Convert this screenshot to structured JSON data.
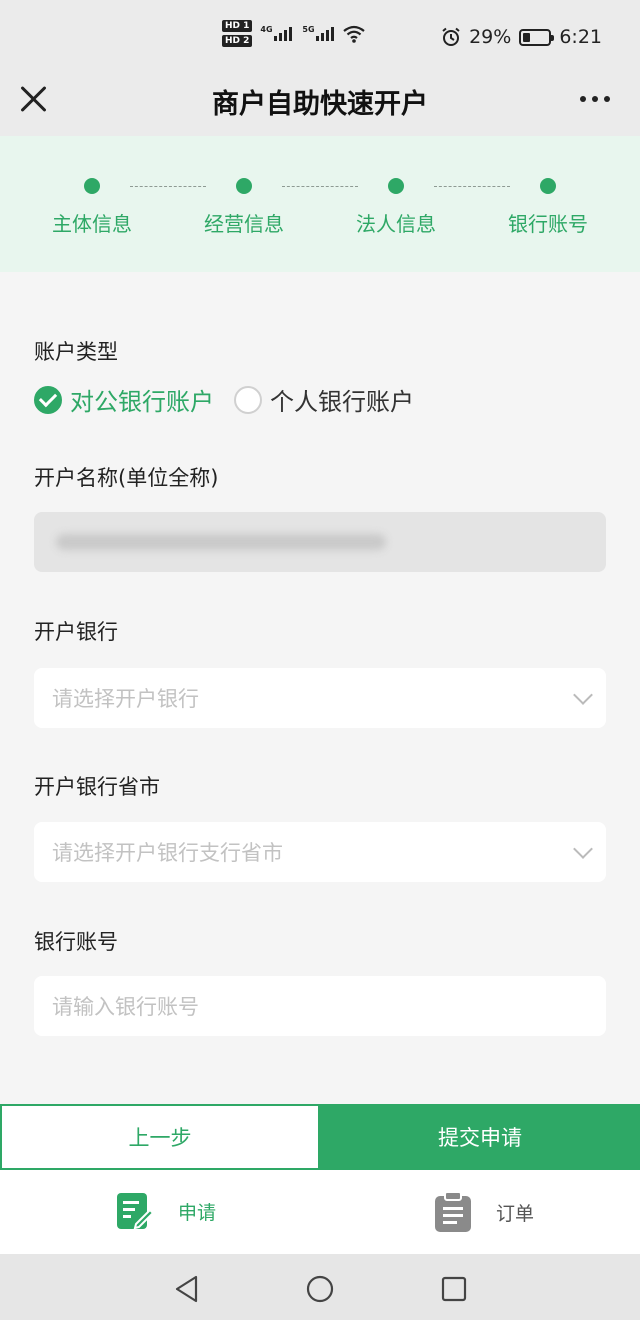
{
  "status_bar": {
    "hd1": "HD 1",
    "hd2": "HD 2",
    "net1": "4G",
    "net2": "5G",
    "battery_percent": "29%",
    "battery_level": 0.29,
    "time": "6:21",
    "icons": [
      "signal-icon",
      "signal-icon",
      "wifi-icon",
      "alarm-icon",
      "battery-icon"
    ]
  },
  "nav": {
    "title": "商户自助快速开户",
    "close_icon": "close-icon",
    "more_icon": "more-icon"
  },
  "steps": [
    {
      "label": "主体信息"
    },
    {
      "label": "经营信息"
    },
    {
      "label": "法人信息"
    },
    {
      "label": "银行账号"
    }
  ],
  "form": {
    "account_type": {
      "label": "账户类型",
      "options": [
        {
          "label": "对公银行账户",
          "checked": true
        },
        {
          "label": "个人银行账户",
          "checked": false
        }
      ]
    },
    "account_name": {
      "label": "开户名称(单位全称)"
    },
    "bank": {
      "label": "开户银行",
      "placeholder": "请选择开户银行"
    },
    "bank_region": {
      "label": "开户银行省市",
      "placeholder": "请选择开户银行支行省市"
    },
    "account_number": {
      "label": "银行账号",
      "placeholder": "请输入银行账号"
    }
  },
  "actions": {
    "prev_label": "上一步",
    "submit_label": "提交申请"
  },
  "tab_bar": {
    "apply_label": "申请",
    "order_label": "订单"
  },
  "colors": {
    "accent": "#2ea866",
    "steps_bg": "#e8f6ee",
    "page_bg": "#f5f5f5"
  }
}
